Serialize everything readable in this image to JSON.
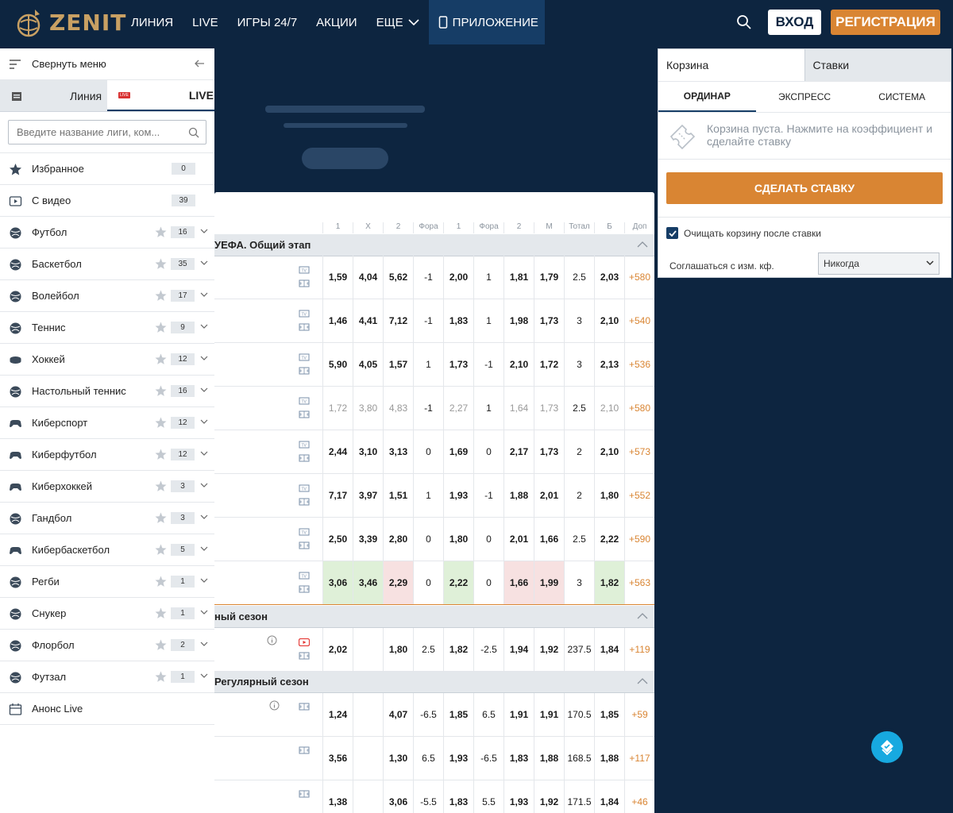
{
  "header": {
    "logo_text": "ZENIT",
    "nav": [
      {
        "label": "ЛИНИЯ"
      },
      {
        "label": "LIVE"
      },
      {
        "label": "ИГРЫ 24/7"
      },
      {
        "label": "АКЦИИ"
      },
      {
        "label": "ЕЩЕ"
      },
      {
        "label": "ПРИЛОЖЕНИЕ"
      }
    ],
    "login_label": "ВХОД",
    "register_label": "РЕГИСТРАЦИЯ",
    "brand_color": "#c8a063",
    "accent_color": "#d98533"
  },
  "sidebar": {
    "collapse_label": "Свернуть меню",
    "tab_line": "Линия",
    "tab_live": "LIVE",
    "live_badge": "LIVE",
    "search_placeholder": "Введите название лиги, ком...",
    "sports": [
      {
        "name": "Избранное",
        "count": "0",
        "icon": "star-icon"
      },
      {
        "name": "С видео",
        "count": "39",
        "icon": "video-icon"
      },
      {
        "name": "Футбол",
        "count": "16",
        "icon": "soccer-ball-icon"
      },
      {
        "name": "Баскетбол",
        "count": "35",
        "icon": "basketball-icon"
      },
      {
        "name": "Волейбол",
        "count": "17",
        "icon": "volleyball-icon"
      },
      {
        "name": "Теннис",
        "count": "9",
        "icon": "tennis-ball-icon"
      },
      {
        "name": "Хоккей",
        "count": "12",
        "icon": "hockey-puck-icon"
      },
      {
        "name": "Настольный теннис",
        "count": "16",
        "icon": "ping-pong-icon"
      },
      {
        "name": "Киберспорт",
        "count": "12",
        "icon": "gamepad-icon"
      },
      {
        "name": "Киберфутбол",
        "count": "12",
        "icon": "gamepad-icon"
      },
      {
        "name": "Киберхоккей",
        "count": "3",
        "icon": "gamepad-icon"
      },
      {
        "name": "Гандбол",
        "count": "3",
        "icon": "handball-icon"
      },
      {
        "name": "Кибербаскетбол",
        "count": "5",
        "icon": "gamepad-icon"
      },
      {
        "name": "Регби",
        "count": "1",
        "icon": "rugby-ball-icon"
      },
      {
        "name": "Снукер",
        "count": "1",
        "icon": "snooker-icon"
      },
      {
        "name": "Флорбол",
        "count": "2",
        "icon": "floorball-icon"
      },
      {
        "name": "Футзал",
        "count": "1",
        "icon": "futsal-icon"
      },
      {
        "name": "Анонс Live",
        "count": "",
        "icon": "calendar-icon"
      }
    ]
  },
  "table": {
    "columns": [
      "1",
      "Х",
      "2",
      "Фора",
      "1",
      "Фора",
      "2",
      "М",
      "Тотал",
      "Б",
      "Доп"
    ],
    "sections": [
      {
        "title": "УЕФА. Общий этап"
      },
      {
        "title": "ный сезон"
      },
      {
        "title": "Регулярный сезон"
      }
    ],
    "rows": [
      {
        "v": [
          "1,59",
          "4,04",
          "5,62",
          "-1",
          "2,00",
          "1",
          "1,81",
          "1,79",
          "2.5",
          "2,03",
          "+580"
        ]
      },
      {
        "v": [
          "1,46",
          "4,41",
          "7,12",
          "-1",
          "1,83",
          "1",
          "1,98",
          "1,73",
          "3",
          "2,10",
          "+540"
        ]
      },
      {
        "v": [
          "5,90",
          "4,05",
          "1,57",
          "1",
          "1,73",
          "-1",
          "2,10",
          "1,72",
          "3",
          "2,13",
          "+536"
        ]
      },
      {
        "v": [
          "1,72",
          "3,80",
          "4,83",
          "-1",
          "2,27",
          "1",
          "1,64",
          "1,73",
          "2.5",
          "2,10",
          "+580"
        ]
      },
      {
        "v": [
          "2,44",
          "3,10",
          "3,13",
          "0",
          "1,69",
          "0",
          "2,17",
          "1,73",
          "2",
          "2,10",
          "+573"
        ]
      },
      {
        "v": [
          "7,17",
          "3,97",
          "1,51",
          "1",
          "1,93",
          "-1",
          "1,88",
          "2,01",
          "2",
          "1,80",
          "+552"
        ]
      },
      {
        "v": [
          "2,50",
          "3,39",
          "2,80",
          "0",
          "1,80",
          "0",
          "2,01",
          "1,66",
          "2.5",
          "2,22",
          "+590"
        ]
      },
      {
        "v": [
          "3,06",
          "3,46",
          "2,29",
          "0",
          "2,22",
          "0",
          "1,66",
          "1,99",
          "3",
          "1,82",
          "+563"
        ]
      },
      {
        "v": [
          "2,02",
          "",
          "1,80",
          "2.5",
          "1,82",
          "-2.5",
          "1,94",
          "1,92",
          "237.5",
          "1,84",
          "+119"
        ]
      },
      {
        "v": [
          "1,24",
          "",
          "4,07",
          "-6.5",
          "1,85",
          "6.5",
          "1,91",
          "1,91",
          "170.5",
          "1,85",
          "+59"
        ]
      },
      {
        "v": [
          "3,56",
          "",
          "1,30",
          "6.5",
          "1,93",
          "-6.5",
          "1,83",
          "1,88",
          "168.5",
          "1,88",
          "+117"
        ]
      },
      {
        "v": [
          "1,38",
          "",
          "3,06",
          "-5.5",
          "1,83",
          "5.5",
          "1,93",
          "1,92",
          "171.5",
          "1,84",
          "+46"
        ]
      }
    ]
  },
  "betslip": {
    "tab_cart": "Корзина",
    "tab_bets": "Ставки",
    "subtab_single": "ОРДИНАР",
    "subtab_express": "ЭКСПРЕСС",
    "subtab_system": "СИСТЕМА",
    "empty_text": "Корзина пуста. Нажмите на коэффициент и сделайте ставку",
    "make_bet_label": "СДЕЛАТЬ СТАВКУ",
    "clear_after_label": "Очищать корзину после ставки",
    "agree_label": "Соглашаться с изм. кф.",
    "agree_value": "Никогда"
  }
}
